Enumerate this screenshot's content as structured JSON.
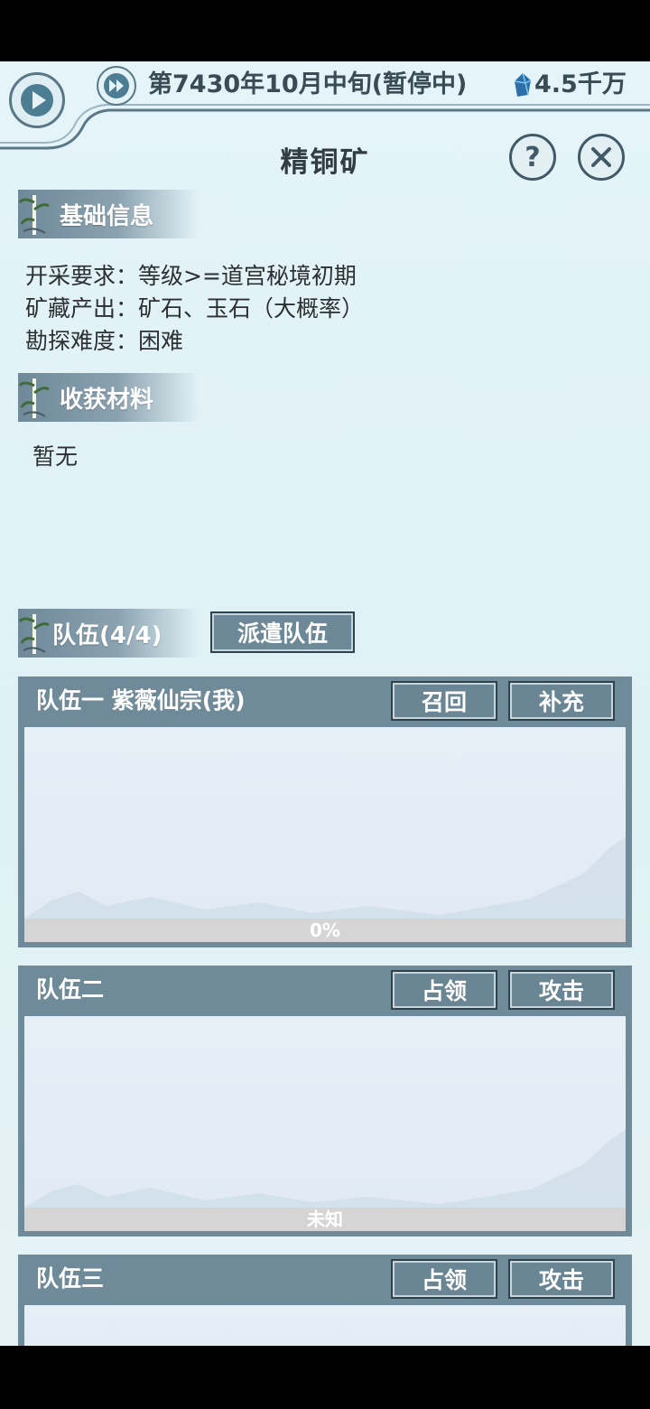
{
  "topbar": {
    "date": "第7430年10月中旬(暂停中)",
    "money": "4.5千万",
    "play_icon": "play-icon",
    "ff_icon": "fast-forward-icon",
    "currency_icon": "spirit-stone-icon"
  },
  "title": "精铜矿",
  "sections": {
    "basic_info": "基础信息",
    "harvest": "收获材料",
    "team": "队伍(4/4)"
  },
  "basic_info": {
    "req": "开采要求：等级>=道宫秘境初期",
    "output": "矿藏产出：矿石、玉石（大概率）",
    "difficulty": "勘探难度：困难"
  },
  "harvest_text": "暂无",
  "dispatch_label": "派遣队伍",
  "teams": [
    {
      "name": "队伍一 紫薇仙宗(我)",
      "btn1": "召回",
      "btn2": "补充",
      "status": "0%"
    },
    {
      "name": "队伍二",
      "btn1": "占领",
      "btn2": "攻击",
      "status": "未知"
    },
    {
      "name": "队伍三",
      "btn1": "占领",
      "btn2": "攻击"
    }
  ],
  "colors": {
    "panel": "#6f8b9a",
    "accent_dark": "#3b4b55",
    "background": "#e4f4f8"
  }
}
